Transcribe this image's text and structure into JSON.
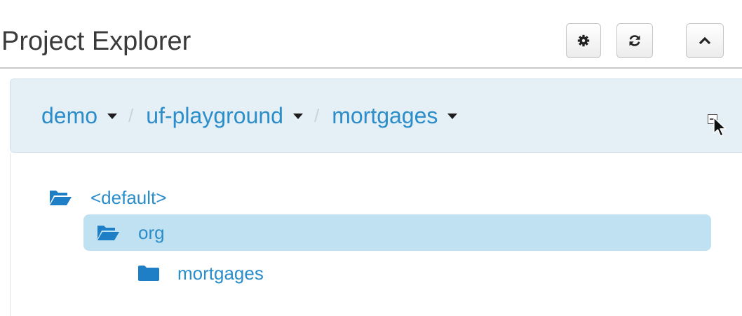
{
  "header": {
    "title": "Project Explorer",
    "buttons": [
      {
        "icon": "gear-icon"
      },
      {
        "icon": "refresh-icon"
      },
      {
        "icon": "chevron-up-icon"
      }
    ]
  },
  "breadcrumb": {
    "items": [
      {
        "label": "demo"
      },
      {
        "label": "uf-playground"
      },
      {
        "label": "mortgages"
      }
    ],
    "separator": "/"
  },
  "tree": {
    "nodes": [
      {
        "label": "<default>",
        "icon": "folder-open-icon",
        "level": 0,
        "selected": false
      },
      {
        "label": "org",
        "icon": "folder-open-icon",
        "level": 1,
        "selected": true
      },
      {
        "label": "mortgages",
        "icon": "folder-icon",
        "level": 2,
        "selected": false
      }
    ]
  },
  "colors": {
    "link": "#2b8dca",
    "breadcrumb_bg": "#e4eff6",
    "selection_bg": "#bfe1f1",
    "folder_icon": "#1e7fc7"
  }
}
